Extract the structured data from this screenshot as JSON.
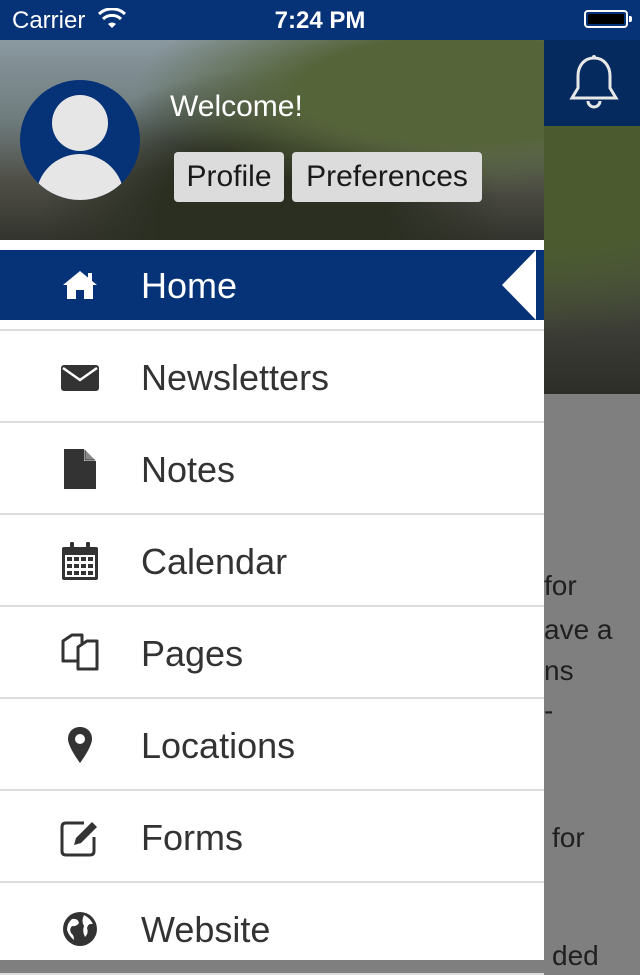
{
  "status_bar": {
    "carrier": "Carrier",
    "time": "7:24 PM"
  },
  "drawer": {
    "welcome": "Welcome!",
    "profile_button": "Profile",
    "preferences_button": "Preferences",
    "menu": [
      {
        "label": "Home",
        "icon": "home-icon",
        "active": true
      },
      {
        "label": "Newsletters",
        "icon": "envelope-icon"
      },
      {
        "label": "Notes",
        "icon": "document-icon"
      },
      {
        "label": "Calendar",
        "icon": "calendar-icon"
      },
      {
        "label": "Pages",
        "icon": "pages-icon"
      },
      {
        "label": "Locations",
        "icon": "map-pin-icon"
      },
      {
        "label": "Forms",
        "icon": "edit-form-icon"
      },
      {
        "label": "Website",
        "icon": "globe-icon"
      }
    ]
  },
  "background": {
    "text_lines": [
      "for",
      "ave a",
      "ns",
      "-",
      "for",
      "ded"
    ]
  },
  "colors": {
    "primary": "#063277",
    "text": "#333333",
    "divider": "#dcdcdc"
  }
}
